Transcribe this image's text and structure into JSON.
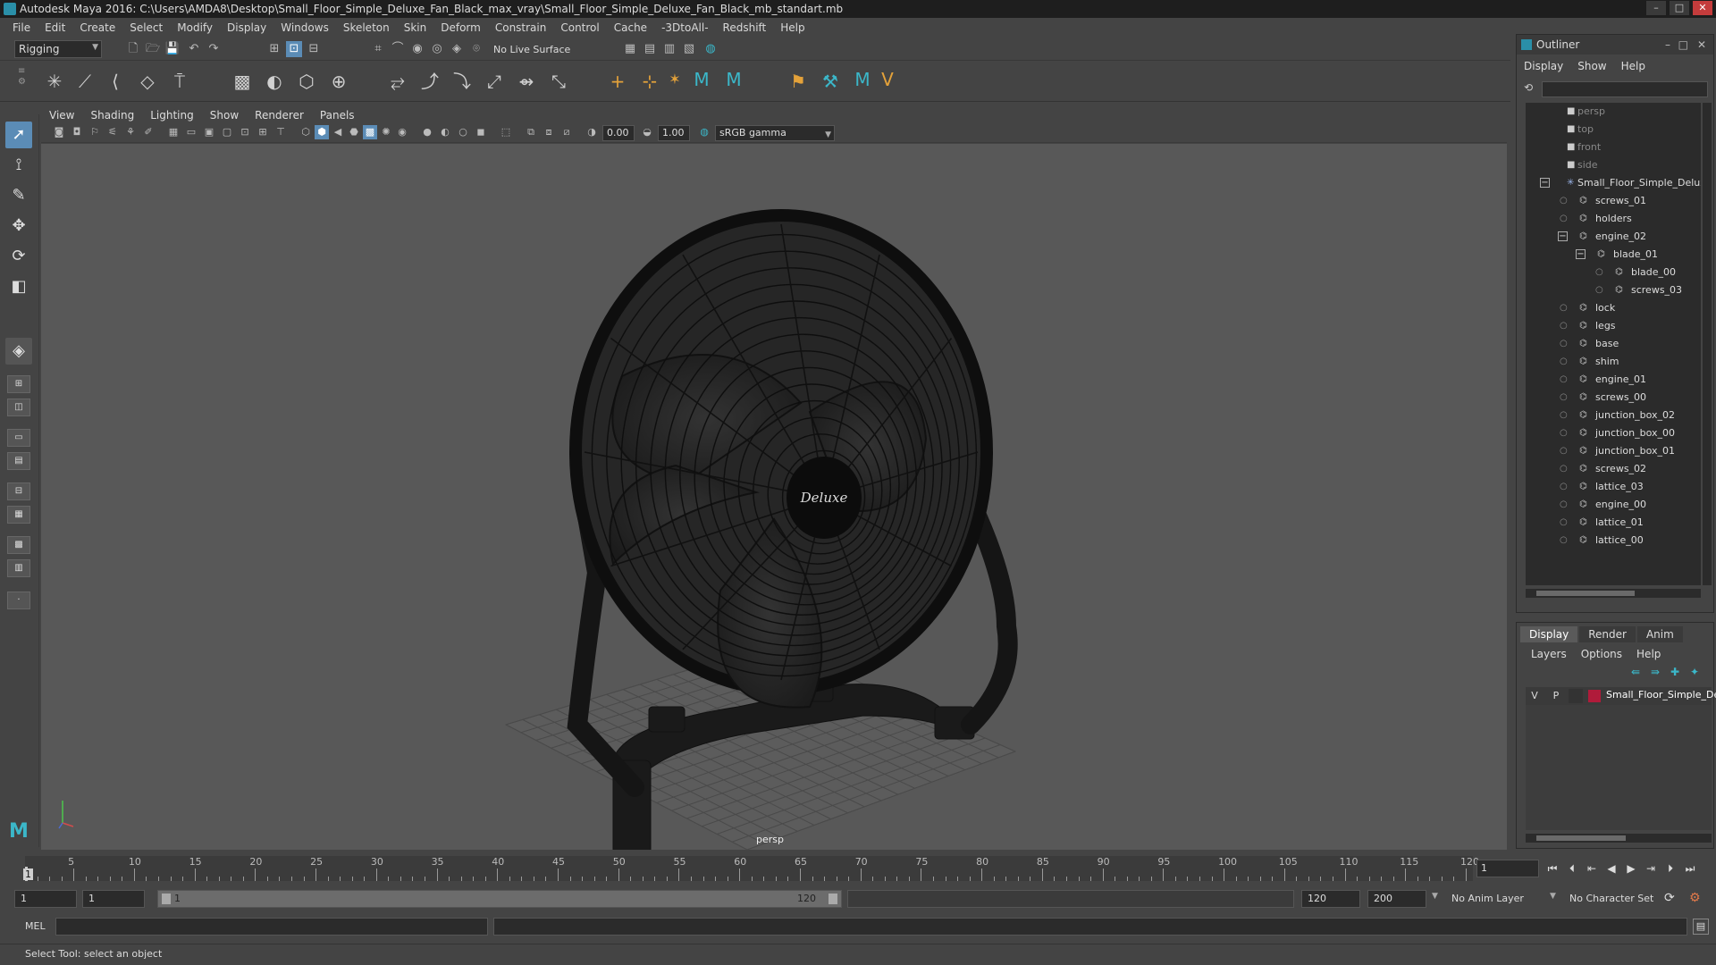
{
  "window": {
    "title": "Autodesk Maya 2016: C:\\Users\\AMDA8\\Desktop\\Small_Floor_Simple_Deluxe_Fan_Black_max_vray\\Small_Floor_Simple_Deluxe_Fan_Black_mb_standart.mb"
  },
  "menubar": [
    "File",
    "Edit",
    "Create",
    "Select",
    "Modify",
    "Display",
    "Windows",
    "Skeleton",
    "Skin",
    "Deform",
    "Constrain",
    "Control",
    "Cache",
    "-3DtoAll-",
    "Redshift",
    "Help"
  ],
  "statusline": {
    "mode": "Rigging",
    "live_surface": "No Live Surface"
  },
  "viewport": {
    "panel_menu": [
      "View",
      "Shading",
      "Lighting",
      "Show",
      "Renderer",
      "Panels"
    ],
    "exposure": "0.00",
    "gamma": "1.00",
    "color_space": "sRGB gamma",
    "camera": "persp",
    "fan_logo": "Deluxe"
  },
  "outliner": {
    "title": "Outliner",
    "menu": [
      "Display",
      "Show",
      "Help"
    ],
    "items": [
      {
        "label": "persp",
        "type": "camera",
        "depth": 0
      },
      {
        "label": "top",
        "type": "camera",
        "depth": 0
      },
      {
        "label": "front",
        "type": "camera",
        "depth": 0
      },
      {
        "label": "side",
        "type": "camera",
        "depth": 0
      },
      {
        "label": "Small_Floor_Simple_Delux",
        "type": "group",
        "depth": 0
      },
      {
        "label": "screws_01",
        "type": "mesh",
        "depth": 1
      },
      {
        "label": "holders",
        "type": "mesh",
        "depth": 1
      },
      {
        "label": "engine_02",
        "type": "mesh",
        "depth": 1
      },
      {
        "label": "blade_01",
        "type": "mesh",
        "depth": 2
      },
      {
        "label": "blade_00",
        "type": "mesh",
        "depth": 3
      },
      {
        "label": "screws_03",
        "type": "mesh",
        "depth": 3
      },
      {
        "label": "lock",
        "type": "mesh",
        "depth": 1
      },
      {
        "label": "legs",
        "type": "mesh",
        "depth": 1
      },
      {
        "label": "base",
        "type": "mesh",
        "depth": 1
      },
      {
        "label": "shim",
        "type": "mesh",
        "depth": 1
      },
      {
        "label": "engine_01",
        "type": "mesh",
        "depth": 1
      },
      {
        "label": "screws_00",
        "type": "mesh",
        "depth": 1
      },
      {
        "label": "junction_box_02",
        "type": "mesh",
        "depth": 1
      },
      {
        "label": "junction_box_00",
        "type": "mesh",
        "depth": 1
      },
      {
        "label": "junction_box_01",
        "type": "mesh",
        "depth": 1
      },
      {
        "label": "screws_02",
        "type": "mesh",
        "depth": 1
      },
      {
        "label": "lattice_03",
        "type": "mesh",
        "depth": 1
      },
      {
        "label": "engine_00",
        "type": "mesh",
        "depth": 1
      },
      {
        "label": "lattice_01",
        "type": "mesh",
        "depth": 1
      },
      {
        "label": "lattice_00",
        "type": "mesh",
        "depth": 1
      }
    ]
  },
  "layer_editor": {
    "tabs": [
      "Display",
      "Render",
      "Anim"
    ],
    "menu": [
      "Layers",
      "Options",
      "Help"
    ],
    "layer": {
      "v": "V",
      "p": "P",
      "name": "Small_Floor_Simple_De",
      "color": "#b01b3a"
    }
  },
  "timeline": {
    "ticks": [
      "5",
      "10",
      "15",
      "20",
      "25",
      "30",
      "35",
      "40",
      "45",
      "50",
      "55",
      "60",
      "65",
      "70",
      "75",
      "80",
      "85",
      "90",
      "95",
      "100",
      "105",
      "110",
      "115",
      "120"
    ],
    "current_frame": "1",
    "start_marker": "1"
  },
  "range": {
    "start": "1",
    "inner_start": "1",
    "slider_start": "1",
    "slider_end": "120",
    "end": "120",
    "max": "200",
    "anim_layer": "No Anim Layer",
    "character_set": "No Character Set"
  },
  "commandline": {
    "label": "MEL"
  },
  "helpline": {
    "text": "Select Tool: select an object"
  }
}
